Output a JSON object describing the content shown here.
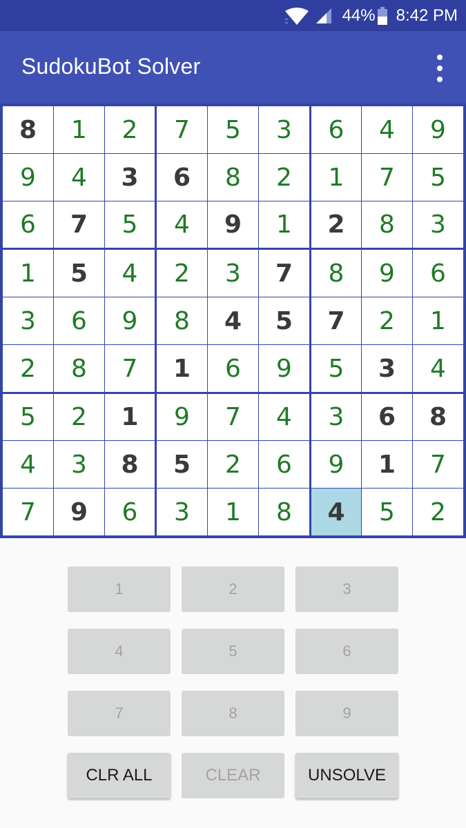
{
  "status_bar": {
    "wifi_icon": "wifi-icon",
    "signal_icon": "cell-signal-icon",
    "battery_percent": "44%",
    "battery_icon": "battery-icon",
    "time": "8:42 PM"
  },
  "app_bar": {
    "title": "SudokuBot Solver",
    "overflow_icon": "more-vert-icon"
  },
  "colors": {
    "status_bar": "#303f9f",
    "app_bar": "#3f51b5",
    "grid_lines": "#3346a6",
    "solved_digit": "#1f7a26",
    "given_digit": "#3a3a3a",
    "selected_cell": "#add8e6",
    "key_bg": "#d6d7d7"
  },
  "board": {
    "selected": {
      "row": 8,
      "col": 6
    },
    "rows": [
      [
        8,
        1,
        2,
        7,
        5,
        3,
        6,
        4,
        9
      ],
      [
        9,
        4,
        3,
        6,
        8,
        2,
        1,
        7,
        5
      ],
      [
        6,
        7,
        5,
        4,
        9,
        1,
        2,
        8,
        3
      ],
      [
        1,
        5,
        4,
        2,
        3,
        7,
        8,
        9,
        6
      ],
      [
        3,
        6,
        9,
        8,
        4,
        5,
        7,
        2,
        1
      ],
      [
        2,
        8,
        7,
        1,
        6,
        9,
        5,
        3,
        4
      ],
      [
        5,
        2,
        1,
        9,
        7,
        4,
        3,
        6,
        8
      ],
      [
        4,
        3,
        8,
        5,
        2,
        6,
        9,
        1,
        7
      ],
      [
        7,
        9,
        6,
        3,
        1,
        8,
        4,
        5,
        2
      ]
    ],
    "given": [
      [
        1,
        0,
        0,
        0,
        0,
        0,
        0,
        0,
        0
      ],
      [
        0,
        0,
        1,
        1,
        0,
        0,
        0,
        0,
        0
      ],
      [
        0,
        1,
        0,
        0,
        1,
        0,
        1,
        0,
        0
      ],
      [
        0,
        1,
        0,
        0,
        0,
        1,
        0,
        0,
        0
      ],
      [
        0,
        0,
        0,
        0,
        1,
        1,
        1,
        0,
        0
      ],
      [
        0,
        0,
        0,
        1,
        0,
        0,
        0,
        1,
        0
      ],
      [
        0,
        0,
        1,
        0,
        0,
        0,
        0,
        1,
        1
      ],
      [
        0,
        0,
        1,
        1,
        0,
        0,
        0,
        1,
        0
      ],
      [
        0,
        1,
        0,
        0,
        0,
        0,
        1,
        0,
        0
      ]
    ]
  },
  "keypad": {
    "digits": [
      "1",
      "2",
      "3",
      "4",
      "5",
      "6",
      "7",
      "8",
      "9"
    ],
    "digits_enabled": false,
    "actions": [
      {
        "label": "CLR ALL",
        "enabled": true
      },
      {
        "label": "CLEAR",
        "enabled": false
      },
      {
        "label": "UNSOLVE",
        "enabled": true
      }
    ]
  }
}
